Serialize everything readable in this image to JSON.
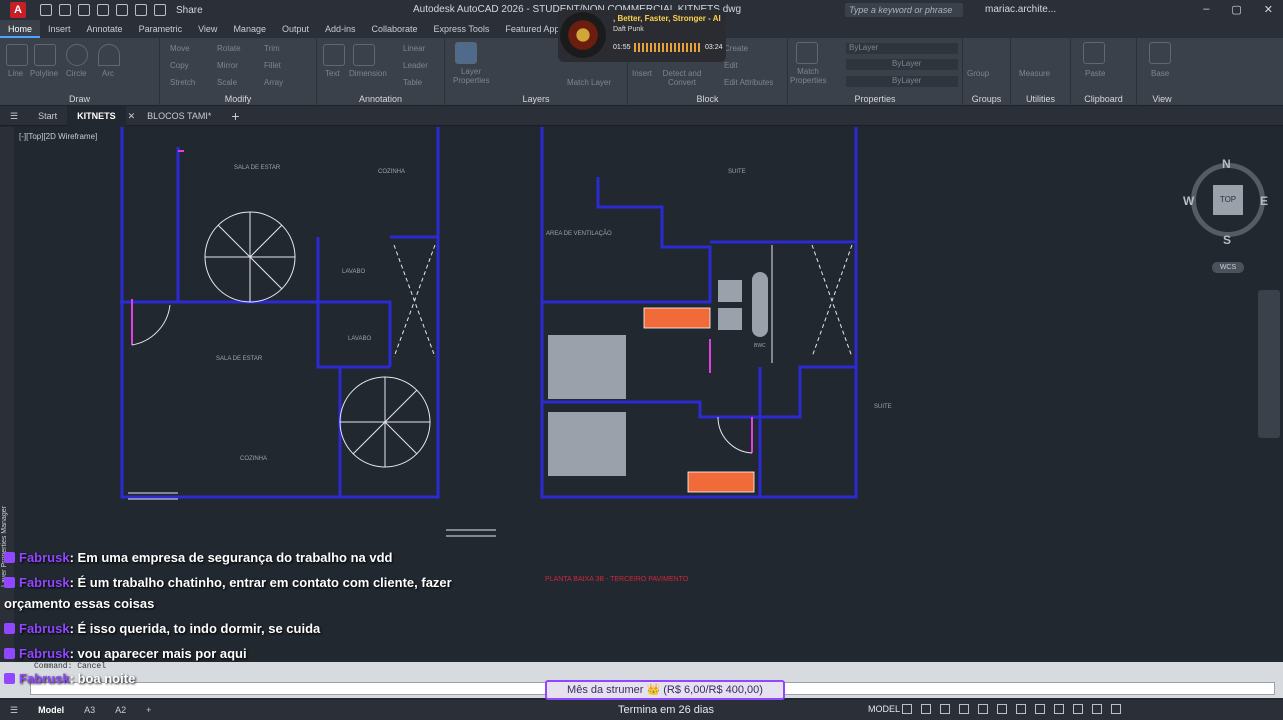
{
  "app": {
    "logo_letter": "A",
    "title": "Autodesk AutoCAD 2026 - STUDENT/NON COMMERCIAL    KITNETS.dwg",
    "share_label": "Share",
    "search_placeholder": "Type a keyword or phrase",
    "user_name": "mariac.archite..."
  },
  "ribbon_tabs": [
    "Home",
    "Insert",
    "Annotate",
    "Parametric",
    "View",
    "Manage",
    "Output",
    "Add-ins",
    "Collaborate",
    "Express Tools",
    "Featured Apps"
  ],
  "ribbon": {
    "draw": {
      "title": "Draw",
      "tools": [
        "Line",
        "Polyline",
        "Circle",
        "Arc"
      ]
    },
    "modify": {
      "title": "Modify",
      "tools": [
        "Move",
        "Rotate",
        "Trim",
        "Copy",
        "Mirror",
        "Fillet",
        "Stretch",
        "Scale",
        "Array"
      ]
    },
    "annotation": {
      "title": "Annotation",
      "tools": [
        "Text",
        "Dimension",
        "Linear",
        "Leader",
        "Table"
      ]
    },
    "layers": {
      "title": "Layers",
      "tools": [
        "Layer Properties",
        "Match Layer"
      ]
    },
    "block": {
      "title": "Block",
      "tools": [
        "Insert",
        "Detect and Convert",
        "Create",
        "Edit",
        "Edit Attributes"
      ]
    },
    "properties": {
      "title": "Properties",
      "tools": [
        "Match Properties",
        "ByLayer",
        "ByLayer",
        "ByLayer"
      ]
    },
    "groups": {
      "title": "Groups",
      "tools": [
        "Group"
      ]
    },
    "utilities": {
      "title": "Utilities",
      "tools": [
        "Measure"
      ]
    },
    "clipboard": {
      "title": "Clipboard",
      "tools": [
        "Paste"
      ]
    },
    "view": {
      "title": "View",
      "tools": [
        "Base"
      ]
    }
  },
  "music": {
    "song": ", Better, Faster, Stronger - AI",
    "artist": "Daft Punk",
    "elapsed": "01:55",
    "duration": "03:24"
  },
  "doc_tabs": [
    "Start",
    "KITNETS",
    "BLOCOS TAMI*"
  ],
  "viewport_label": "[-][Top][2D Wireframe]",
  "side_palette_label": "Layer Properties Manager",
  "drawing_labels": {
    "sala_estar_top": "SALA DE ESTAR",
    "cozinha_top": "COZINHA",
    "lavabo_1": "LAVABO",
    "lavabo_2": "LAVABO",
    "sala_estar_bottom": "SALA DE ESTAR",
    "cozinha_bottom": "COZINHA",
    "suite_top": "SUITE",
    "area_ventilacao": "AREA DE VENTILAÇÃO",
    "banheiro": "BWC",
    "suite_right": "SUITE",
    "planta_title": "PLANTA BAIXA 3B - TERCEIRO PAVIMENTO"
  },
  "viewcube": {
    "north": "N",
    "south": "S",
    "east": "E",
    "west": "W",
    "face": "TOP",
    "wcs": "WCS"
  },
  "chat": [
    {
      "user": "Fabrusk",
      "message": ": Em uma empresa de segurança do trabalho na vdd"
    },
    {
      "user": "Fabrusk",
      "message": ": É um trabalho chatinho, entrar em contato com cliente, fazer"
    },
    {
      "user": "",
      "message": "orçamento essas coisas"
    },
    {
      "user": "Fabrusk",
      "message": ": É isso querida, to indo dormir, se cuida"
    },
    {
      "user": "Fabrusk",
      "message": ": vou aparecer mais por aqui"
    },
    {
      "user": "Fabrusk",
      "message": ": boa noite"
    }
  ],
  "command_history": "Command: Cancel",
  "sub_banner": "Mês da strumer 👑 (R$ 6,00/R$ 400,00)",
  "status": {
    "layout_tabs": [
      "Model",
      "A3",
      "A2"
    ],
    "ends_in": "Termina em 26 dias",
    "model_label": "MODEL"
  },
  "colors": {
    "chat_user": "#9147ff",
    "walls": "#2c2ad0",
    "accent": "#4aa3ff",
    "app_red": "#c42026"
  }
}
